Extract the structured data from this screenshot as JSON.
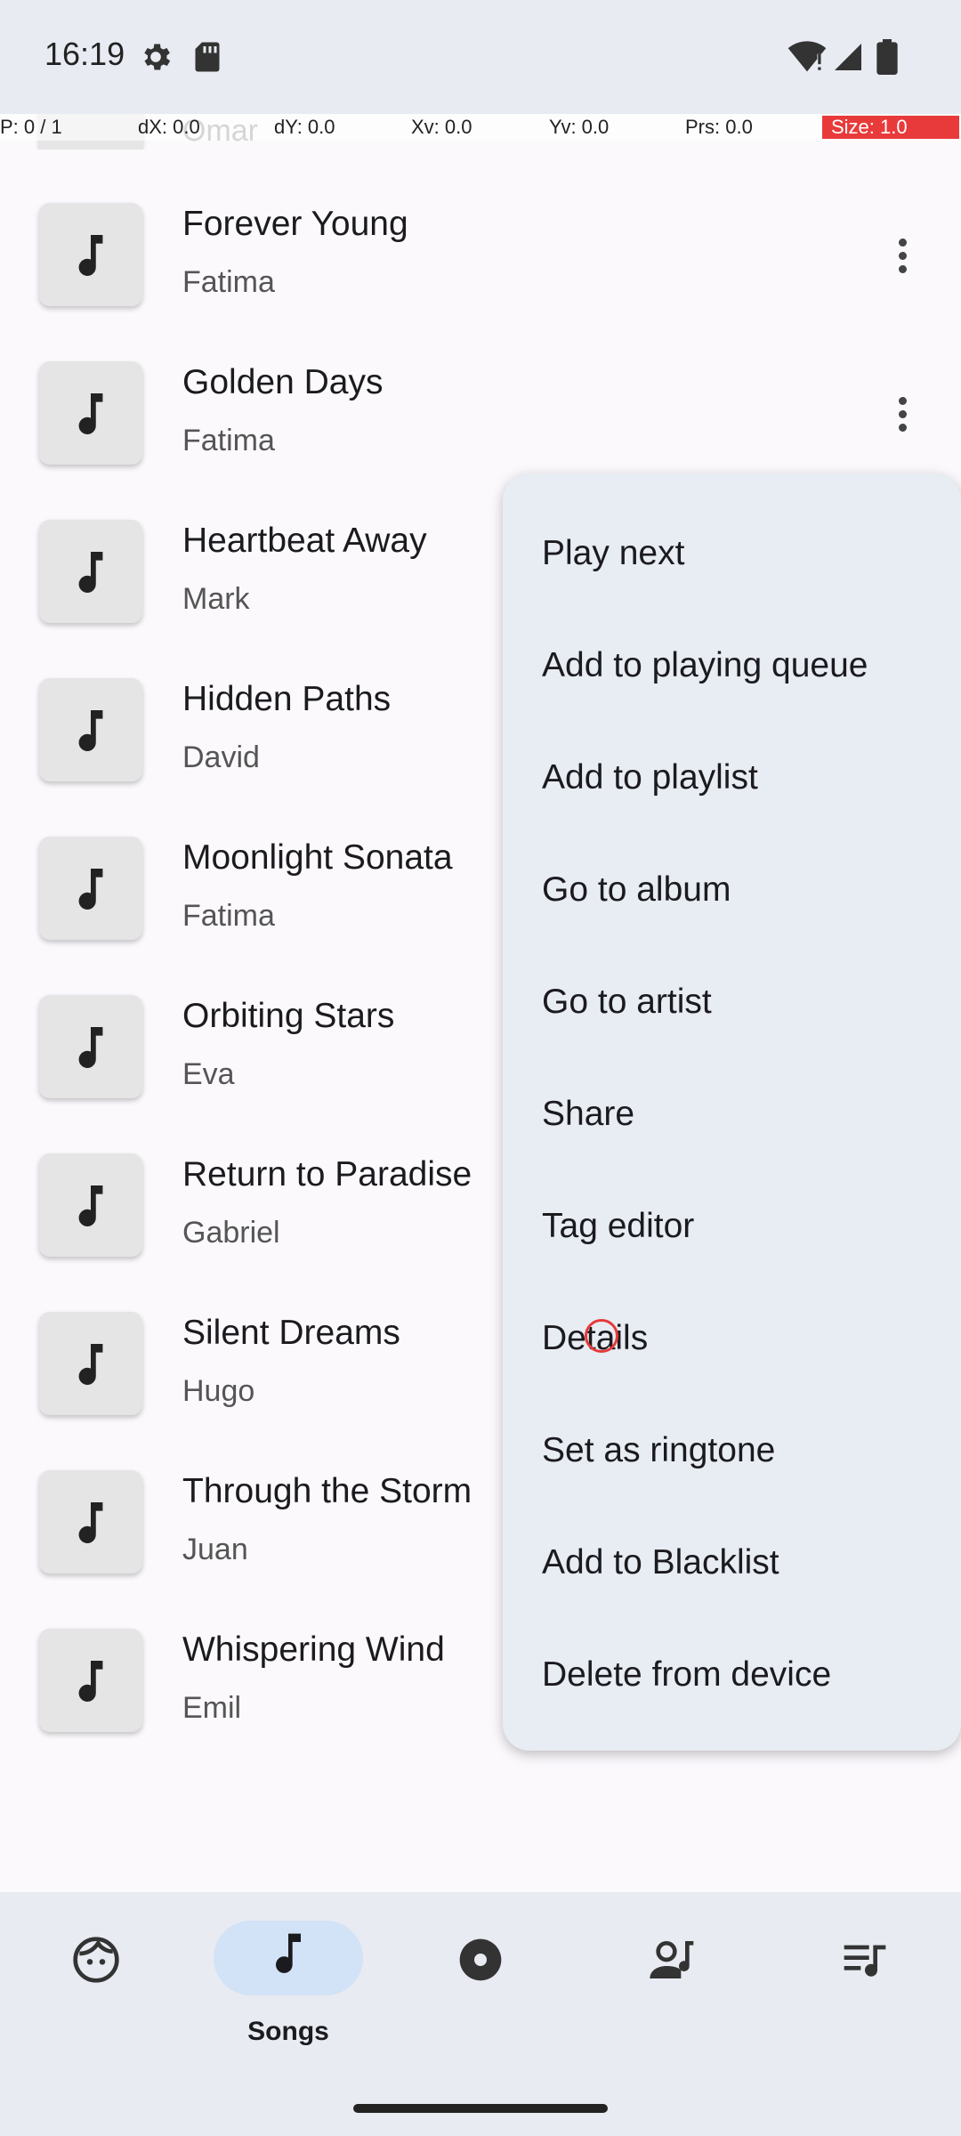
{
  "status_bar": {
    "time": "16:19",
    "icons": [
      "gear-icon",
      "sd-card-icon",
      "wifi-alert-icon",
      "cell-signal-icon",
      "battery-icon"
    ]
  },
  "debug_overlay": {
    "pointer": "P: 0 / 1",
    "dx": "dX: 0.0",
    "dy": "dY: 0.0",
    "xv": "Xv: 0.0",
    "yv": "Yv: 0.0",
    "prs": "Prs: 0.0",
    "size": "Size: 1.0"
  },
  "song_list": {
    "partial_top_artist": "Omar",
    "songs": [
      {
        "title": "Forever Young",
        "artist": "Fatima"
      },
      {
        "title": "Golden Days",
        "artist": "Fatima"
      },
      {
        "title": "Heartbeat Away",
        "artist": "Mark"
      },
      {
        "title": "Hidden Paths",
        "artist": "David"
      },
      {
        "title": "Moonlight Sonata",
        "artist": "Fatima"
      },
      {
        "title": "Orbiting Stars",
        "artist": "Eva"
      },
      {
        "title": "Return to Paradise",
        "artist": "Gabriel"
      },
      {
        "title": "Silent Dreams",
        "artist": "Hugo"
      },
      {
        "title": "Through the Storm",
        "artist": "Juan"
      },
      {
        "title": "Whispering Wind",
        "artist": "Emil"
      }
    ]
  },
  "context_menu": {
    "items": [
      "Play next",
      "Add to playing queue",
      "Add to playlist",
      "Go to album",
      "Go to artist",
      "Share",
      "Tag editor",
      "Details",
      "Set as ringtone",
      "Add to Blacklist",
      "Delete from device"
    ]
  },
  "bottom_nav": {
    "active": "Songs",
    "items": [
      {
        "icon": "face-icon",
        "label": ""
      },
      {
        "icon": "music-note-icon",
        "label": "Songs"
      },
      {
        "icon": "album-icon",
        "label": ""
      },
      {
        "icon": "artist-icon",
        "label": ""
      },
      {
        "icon": "playlist-icon",
        "label": ""
      }
    ]
  },
  "colors": {
    "background": "#fbf9fc",
    "bars": "#e8ebf1",
    "menu": "#e8ecf3",
    "active_pill": "#d2e2f7",
    "tap_indicator": "#e83a3a"
  }
}
